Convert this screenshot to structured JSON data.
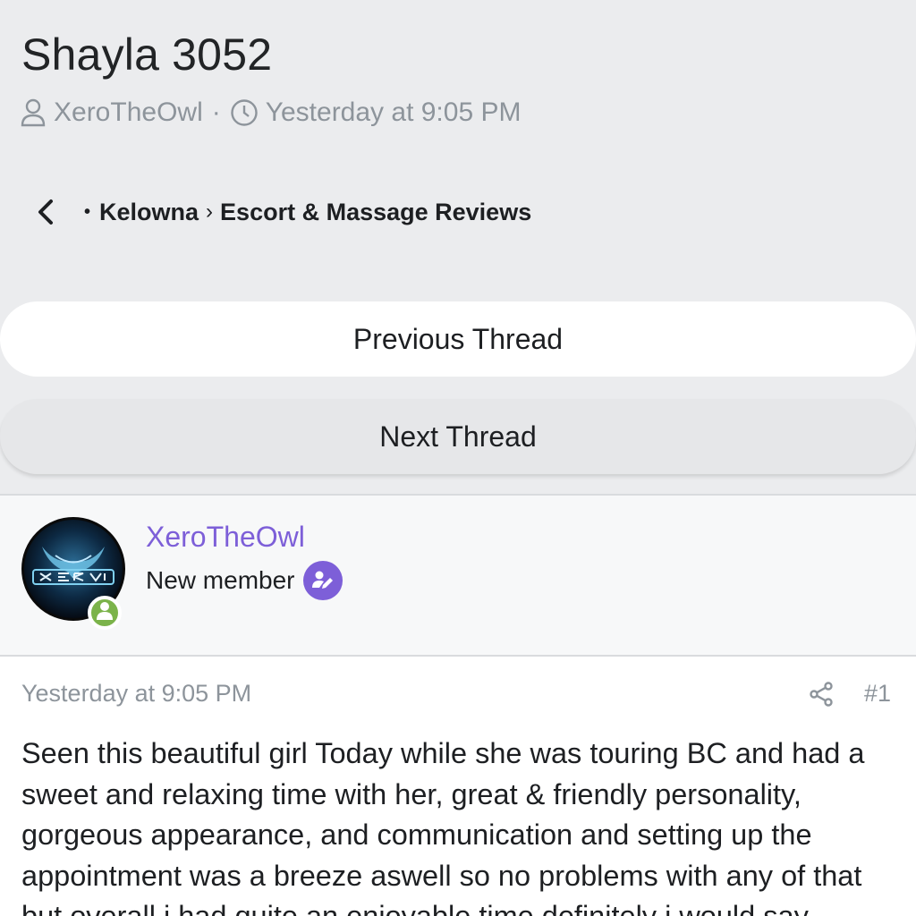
{
  "thread": {
    "title": "Shayla 3052",
    "author": "XeroTheOwl",
    "meta_separator": "·",
    "timestamp": "Yesterday at 9:05 PM"
  },
  "breadcrumb": {
    "dot": "•",
    "items": [
      "Kelowna",
      "Escort & Massage Reviews"
    ],
    "separator": "›"
  },
  "navigation": {
    "previous_label": "Previous Thread",
    "next_label": "Next Thread"
  },
  "author_block": {
    "name": "XeroTheOwl",
    "role": "New member",
    "online": true
  },
  "post": {
    "date": "Yesterday at 9:05 PM",
    "number": "#1",
    "lines": [
      "Seen this beautiful girl Today while she was touring BC and had a",
      "sweet and relaxing time with her, great & friendly personality,",
      "gorgeous appearance, and communication and setting up the",
      "appointment was a breeze aswell so no problems with any of that",
      "but overall i had quite an enjoyable time definitely i would say"
    ]
  },
  "icons": {
    "author": "user-icon",
    "time": "clock-icon",
    "back": "chevron-left-icon",
    "share": "share-icon",
    "role": "pencil-badge-icon",
    "online": "user-online-icon"
  },
  "colors": {
    "background": "#ebecee",
    "accent": "#7d5fd8",
    "online": "#7bb34a",
    "muted_text": "#8d949b"
  }
}
